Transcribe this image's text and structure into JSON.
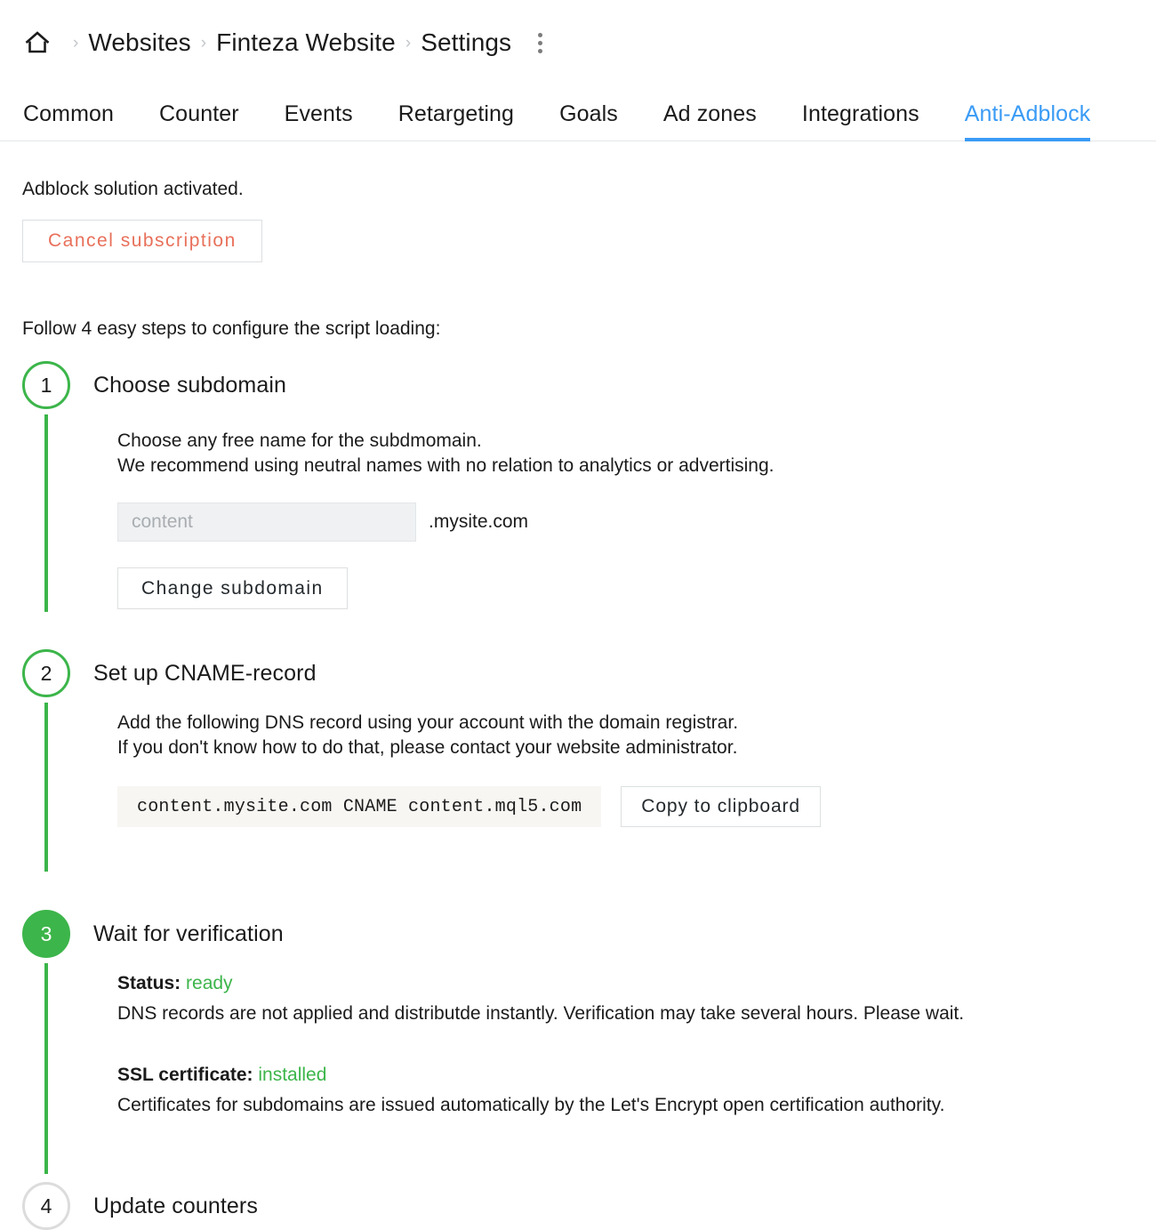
{
  "breadcrumb": {
    "home_icon": "home-icon",
    "separator": "›",
    "items": [
      "Websites",
      "Finteza Website",
      "Settings"
    ],
    "menu_icon": "kebab-menu-icon"
  },
  "tabs": [
    {
      "label": "Common",
      "active": false
    },
    {
      "label": "Counter",
      "active": false
    },
    {
      "label": "Events",
      "active": false
    },
    {
      "label": "Retargeting",
      "active": false
    },
    {
      "label": "Goals",
      "active": false
    },
    {
      "label": "Ad zones",
      "active": false
    },
    {
      "label": "Integrations",
      "active": false
    },
    {
      "label": "Anti-Adblock",
      "active": true
    }
  ],
  "colors": {
    "accent_blue": "#3a9bf5",
    "success_green": "#3cb54a",
    "danger_coral": "#e8705a",
    "border_gray": "#dcdfe1"
  },
  "main": {
    "activated_text": "Adblock solution activated.",
    "cancel_button": "Cancel subscription",
    "follow_text": "Follow 4 easy steps to configure the script loading:",
    "steps": [
      {
        "number": "1",
        "title": "Choose subdomain",
        "state": "outline-green",
        "para_line1": "Choose any free name for the subdmomain.",
        "para_line2": "We recommend using neutral names with no relation to analytics or advertising.",
        "input_placeholder": "content",
        "input_value": "",
        "domain_suffix": ".mysite.com",
        "change_button": "Change subdomain"
      },
      {
        "number": "2",
        "title": "Set up CNAME-record",
        "state": "outline-green",
        "para_line1": "Add the following DNS record using your account with the domain registrar.",
        "para_line2": "If you don't know how to do that, please contact your website administrator.",
        "cname_record": "content.mysite.com CNAME content.mql5.com",
        "copy_button": "Copy to clipboard"
      },
      {
        "number": "3",
        "title": "Wait for verification",
        "state": "filled-green",
        "status_label": "Status:",
        "status_value": "ready",
        "status_note": "DNS records are not applied and distributde instantly. Verification may take several hours. Please wait.",
        "ssl_label": "SSL certificate:",
        "ssl_value": "installed",
        "ssl_note": "Certificates for subdomains are issued automatically by the Let's Encrypt open certification authority."
      },
      {
        "number": "4",
        "title": "Update counters",
        "state": "outline-gray"
      }
    ]
  }
}
